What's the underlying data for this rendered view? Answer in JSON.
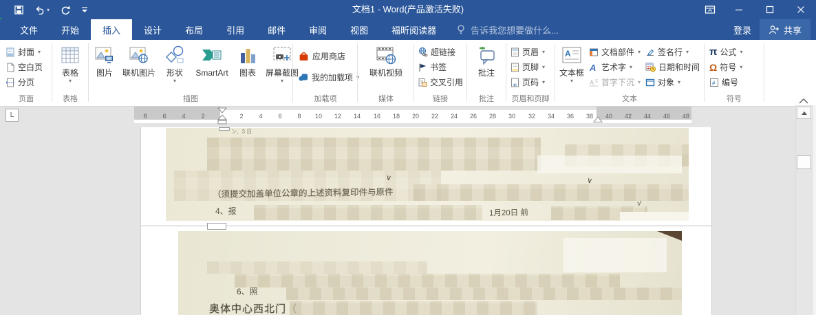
{
  "titlebar": {
    "title": "文档1 - Word(产品激活失败)"
  },
  "tabs": {
    "items": [
      "文件",
      "开始",
      "插入",
      "设计",
      "布局",
      "引用",
      "邮件",
      "审阅",
      "视图",
      "福昕阅读器"
    ],
    "active": "插入",
    "tell_me": "告诉我您想要做什么...",
    "sign_in": "登录",
    "share": "共享"
  },
  "ribbon": {
    "groups": [
      {
        "label": "页面",
        "buttons": [
          "封面",
          "空白页",
          "分页"
        ]
      },
      {
        "label": "表格",
        "buttons": [
          "表格"
        ]
      },
      {
        "label": "插图",
        "buttons": [
          "图片",
          "联机图片",
          "形状",
          "SmartArt",
          "图表",
          "屏幕截图"
        ]
      },
      {
        "label": "加载项",
        "buttons": [
          "应用商店",
          "我的加载项"
        ]
      },
      {
        "label": "媒体",
        "buttons": [
          "联机视频"
        ]
      },
      {
        "label": "链接",
        "buttons": [
          "超链接",
          "书签",
          "交叉引用"
        ]
      },
      {
        "label": "批注",
        "buttons": [
          "批注"
        ]
      },
      {
        "label": "页眉和页脚",
        "buttons": [
          "页眉",
          "页脚",
          "页码"
        ]
      },
      {
        "label": "文本",
        "buttons": [
          "文本框",
          "文档部件",
          "艺术字",
          "首字下沉",
          "签名行",
          "日期和时间",
          "对象"
        ]
      },
      {
        "label": "符号",
        "buttons": [
          "公式",
          "符号",
          "编号"
        ]
      }
    ]
  },
  "icons": {
    "dropdown": "▾",
    "pi": "π",
    "omega": "Ω",
    "hash": "#"
  },
  "ruler": {
    "tab_selector": "L",
    "left": [
      "8",
      "6",
      "4",
      "2"
    ],
    "mid": [
      "2",
      "4",
      "6",
      "8",
      "10",
      "12",
      "14",
      "16",
      "18",
      "20",
      "22",
      "24",
      "26",
      "28",
      "30",
      "32",
      "34",
      "36",
      "38"
    ],
    "right": [
      "40",
      "42",
      "44",
      "46",
      "48"
    ]
  },
  "document": {
    "page1": {
      "top_fragment": "ン、3 日",
      "line1": "（须提交加盖单位公章的上述资料复印件与原件",
      "item4": "4、报",
      "date": "1月20日 前",
      "check1": "∨",
      "check2": "∨",
      "check3": "√"
    },
    "page2": {
      "item6": "6、照",
      "venue": "奥体中心西北门（"
    }
  },
  "colors": {
    "titlebar_blue": "#2b579a",
    "active_tab_text": "#2b579a",
    "store_icon_red": "#d83b01",
    "photo_paper": "#ece8d5"
  }
}
